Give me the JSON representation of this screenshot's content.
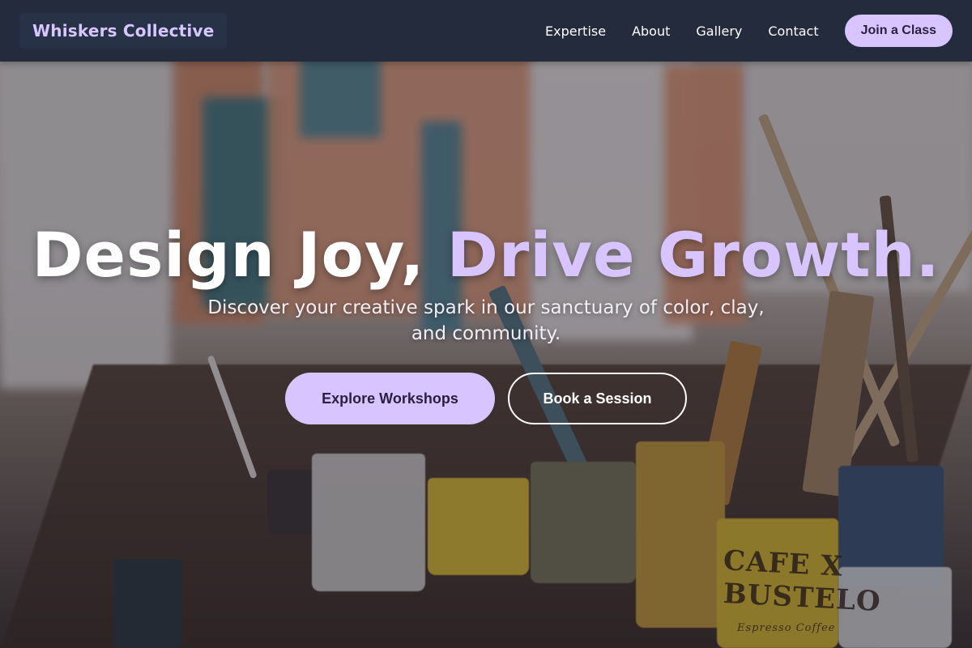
{
  "header": {
    "brand": "Whiskers Collective",
    "nav": [
      "Expertise",
      "About",
      "Gallery",
      "Contact"
    ],
    "cta_label": "Join a Class"
  },
  "hero": {
    "headline_main": "Design Joy, ",
    "headline_accent": "Drive Growth.",
    "subhead": "Discover your creative spark in our sanctuary of color, clay, and community.",
    "primary_cta": "Explore Workshops",
    "secondary_cta": "Book a Session",
    "background": {
      "can_label_line1": "CAFE X",
      "can_label_line2": "BUSTELO",
      "can_label_line3": "Espresso Coffee"
    }
  },
  "colors": {
    "header_bg": "#232b3d",
    "accent": "#d8c5ff",
    "text_light": "#ffffff"
  }
}
